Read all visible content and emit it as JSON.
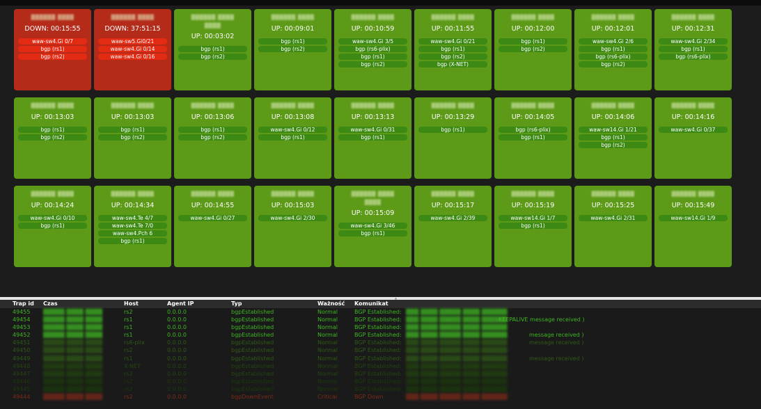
{
  "tiles": [
    {
      "status": "DOWN: 00:15:55",
      "state": "down",
      "chips": [
        "waw-sw4.Gi 0/7",
        "bgp (rs1)",
        "bgp (rs2)"
      ]
    },
    {
      "status": "DOWN: 37:51:15",
      "state": "down",
      "chips": [
        "waw-sw5.Gi0/21",
        "waw-sw4.Gi 0/14",
        "waw-sw4.Gi 0/16"
      ]
    },
    {
      "status": "UP: 00:03:02",
      "state": "up",
      "tall": true,
      "chips": [
        "bgp (rs1)",
        "bgp (rs2)"
      ]
    },
    {
      "status": "UP: 00:09:01",
      "state": "up",
      "chips": [
        "bgp (rs1)",
        "bgp (rs2)"
      ]
    },
    {
      "status": "UP: 00:10:59",
      "state": "up",
      "chips": [
        "waw-sw4.Gi 3/5",
        "bgp (rs6-plix)",
        "bgp (rs1)",
        "bgp (rs2)"
      ]
    },
    {
      "status": "UP: 00:11:55",
      "state": "up",
      "chips": [
        "waw-sw4.Gi 0/21",
        "bgp (rs1)",
        "bgp (rs2)",
        "bgp (X-NET)"
      ]
    },
    {
      "status": "UP: 00:12:00",
      "state": "up",
      "chips": [
        "bgp (rs1)",
        "bgp (rs2)"
      ]
    },
    {
      "status": "UP: 00:12:01",
      "state": "up",
      "chips": [
        "waw-sw4.Gi 2/6",
        "bgp (rs1)",
        "bgp (rs6-plix)",
        "bgp (rs2)"
      ]
    },
    {
      "status": "UP: 00:12:31",
      "state": "up",
      "chips": [
        "waw-sw4.Gi 2/34",
        "bgp (rs1)",
        "bgp (rs6-plix)"
      ]
    },
    {
      "status": "UP: 00:13:03",
      "state": "up",
      "chips": [
        "bgp (rs1)",
        "bgp (rs2)"
      ]
    },
    {
      "status": "UP: 00:13:03",
      "state": "up",
      "chips": [
        "bgp (rs1)",
        "bgp (rs2)"
      ]
    },
    {
      "status": "UP: 00:13:06",
      "state": "up",
      "chips": [
        "bgp (rs1)",
        "bgp (rs2)"
      ]
    },
    {
      "status": "UP: 00:13:08",
      "state": "up",
      "chips": [
        "waw-sw4.Gi 0/12",
        "bgp (rs1)"
      ]
    },
    {
      "status": "UP: 00:13:13",
      "state": "up",
      "chips": [
        "waw-sw4.Gi 0/31",
        "bgp (rs1)"
      ]
    },
    {
      "status": "UP: 00:13:29",
      "state": "up",
      "chips": [
        "bgp (rs1)"
      ]
    },
    {
      "status": "UP: 00:14:05",
      "state": "up",
      "chips": [
        "bgp (rs6-plix)",
        "bgp (rs1)"
      ]
    },
    {
      "status": "UP: 00:14:06",
      "state": "up",
      "chips": [
        "waw-sw14.Gi 1/21",
        "bgp (rs1)",
        "bgp (rs2)"
      ]
    },
    {
      "status": "UP: 00:14:16",
      "state": "up",
      "chips": [
        "waw-sw4.Gi 0/37"
      ]
    },
    {
      "status": "UP: 00:14:24",
      "state": "up",
      "chips": [
        "waw-sw4.Gi 0/10",
        "bgp (rs1)"
      ]
    },
    {
      "status": "UP: 00:14:34",
      "state": "up",
      "chips": [
        "waw-sw4.Te 4/7",
        "waw-sw4.Te 7/0",
        "waw-sw4.Pch 6",
        "bgp (rs1)"
      ]
    },
    {
      "status": "UP: 00:14:55",
      "state": "up",
      "chips": [
        "waw-sw4.Gi 0/27"
      ]
    },
    {
      "status": "UP: 00:15:03",
      "state": "up",
      "chips": [
        "waw-sw4.Gi 2/30"
      ]
    },
    {
      "status": "UP: 00:15:09",
      "state": "up",
      "tall": true,
      "chips": [
        "waw-sw4.Gi 3/46",
        "bgp (rs1)"
      ]
    },
    {
      "status": "UP: 00:15:17",
      "state": "up",
      "chips": [
        "waw-sw4.Gi 2/39"
      ]
    },
    {
      "status": "UP: 00:15:19",
      "state": "up",
      "chips": [
        "waw-sw14.Gi 1/7",
        "bgp (rs1)"
      ]
    },
    {
      "status": "UP: 00:15:25",
      "state": "up",
      "chips": [
        "waw-sw4.Gi 2/31"
      ]
    },
    {
      "status": "UP: 00:15:49",
      "state": "up",
      "chips": [
        "waw-sw14.Gi 1/9"
      ]
    }
  ],
  "traps": {
    "columns": [
      "Trap id",
      "Czas",
      "Host",
      "Agent IP",
      "Typ",
      "Ważność",
      "Komunikat"
    ],
    "rows": [
      {
        "id": "49455",
        "host": "rs2",
        "ip": "0.0.0.0",
        "type": "bgpEstablished",
        "severity": "Normal",
        "msg": "BGP Established:",
        "style": "bright"
      },
      {
        "id": "49454",
        "host": "rs1",
        "ip": "0.0.0.0",
        "type": "bgpEstablished",
        "severity": "Normal",
        "msg": "BGP Established:",
        "style": "bright",
        "msg_tail": "KEEPALIVE message received )"
      },
      {
        "id": "49453",
        "host": "rs1",
        "ip": "0.0.0.0",
        "type": "bgpEstablished",
        "severity": "Normal",
        "msg": "BGP Established:",
        "style": "bright"
      },
      {
        "id": "49452",
        "host": "rs1",
        "ip": "0.0.0.0",
        "type": "bgpEstablished",
        "severity": "Normal",
        "msg": "BGP Established:",
        "style": "bright",
        "msg_tail": "message received )"
      },
      {
        "id": "49451",
        "host": "rs6-plix",
        "ip": "0.0.0.0",
        "type": "bgpEstablished",
        "severity": "Normal",
        "msg": "BGP Established:",
        "style": "fade",
        "msg_tail": "message received )"
      },
      {
        "id": "49450",
        "host": "rs2",
        "ip": "0.0.0.0",
        "type": "bgpEstablished",
        "severity": "Normal",
        "msg": "BGP Established:",
        "style": "fade"
      },
      {
        "id": "49449",
        "host": "rs1",
        "ip": "0.0.0.0",
        "type": "bgpEstablished",
        "severity": "Normal",
        "msg": "BGP Established:",
        "style": "fade",
        "msg_tail": "message received )"
      },
      {
        "id": "49448",
        "host": "X-NET",
        "ip": "0.0.0.0",
        "type": "bgpEstablished",
        "severity": "Normal",
        "msg": "BGP Established:",
        "style": "fade2"
      },
      {
        "id": "49447",
        "host": "rs2",
        "ip": "0.0.0.0",
        "type": "bgpEstablished",
        "severity": "Normal",
        "msg": "BGP Established:",
        "style": "fade2"
      },
      {
        "id": "49446",
        "host": "rs2",
        "ip": "0.0.0.0",
        "type": "bgpEstablished",
        "severity": "Normal",
        "msg": "BGP Established:",
        "style": "fade3"
      },
      {
        "id": "49445",
        "host": "rs2",
        "ip": "0.0.0.0",
        "type": "bgpEstablished",
        "severity": "Normal",
        "msg": "BGP Established:",
        "style": "fade3"
      },
      {
        "id": "49444",
        "host": "rs2",
        "ip": "0.0.0.0",
        "type": "bgpDownEvent",
        "severity": "Critical",
        "msg": "BGP Down",
        "style": "crit"
      }
    ]
  },
  "colors": {
    "up": "#5c9a18",
    "down": "#b42b1a",
    "chip_up": "#3c8a14",
    "chip_down": "#e32a12",
    "trap_green": "#3fb622"
  }
}
